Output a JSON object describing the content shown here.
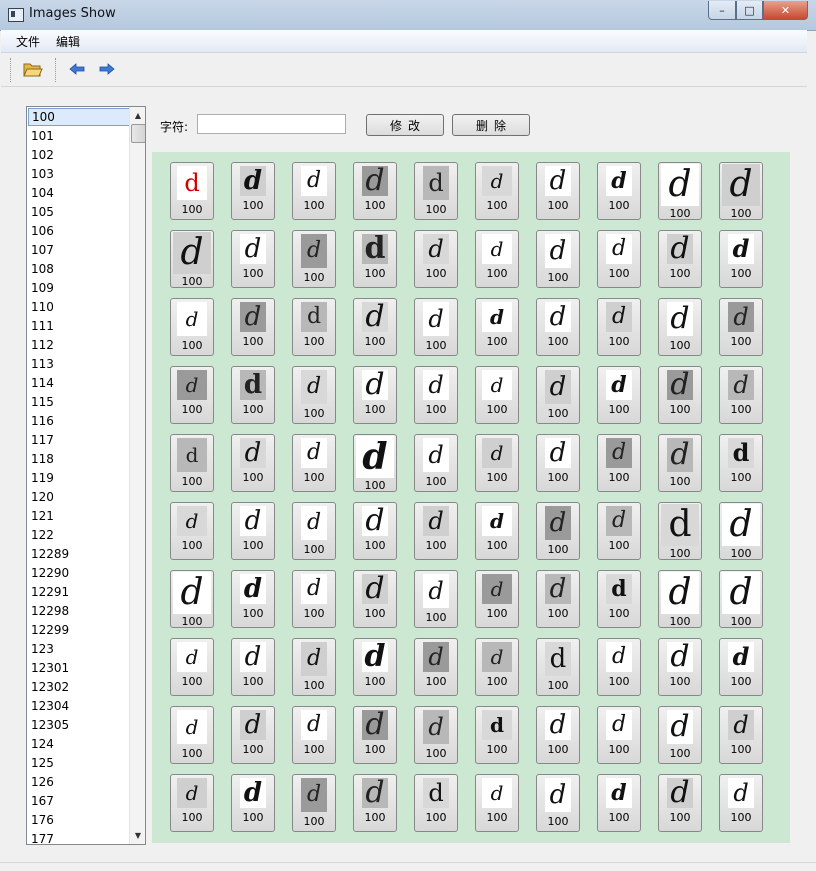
{
  "window": {
    "title": "Images Show",
    "min": "–",
    "max": "□",
    "close": "✕"
  },
  "menu": {
    "file": "文件",
    "edit": "编辑"
  },
  "toolbar": {
    "open_icon": "folder-open-icon",
    "back_icon": "arrow-left-icon",
    "forward_icon": "arrow-right-icon"
  },
  "list": {
    "items": [
      "100",
      "101",
      "102",
      "103",
      "104",
      "105",
      "106",
      "107",
      "108",
      "109",
      "110",
      "111",
      "112",
      "113",
      "114",
      "115",
      "116",
      "117",
      "118",
      "119",
      "120",
      "121",
      "122",
      "12289",
      "12290",
      "12291",
      "12298",
      "12299",
      "123",
      "12301",
      "12302",
      "12304",
      "12305",
      "124",
      "125",
      "126",
      "167",
      "176",
      "177"
    ],
    "selected_index": 0
  },
  "form": {
    "label": "字符:",
    "value": "",
    "modify_label": "修改",
    "delete_label": "删除"
  },
  "grid": {
    "caption": "100",
    "first_glyph": {
      "char": "d",
      "color": "#d40000"
    },
    "glyph_char": "d"
  }
}
